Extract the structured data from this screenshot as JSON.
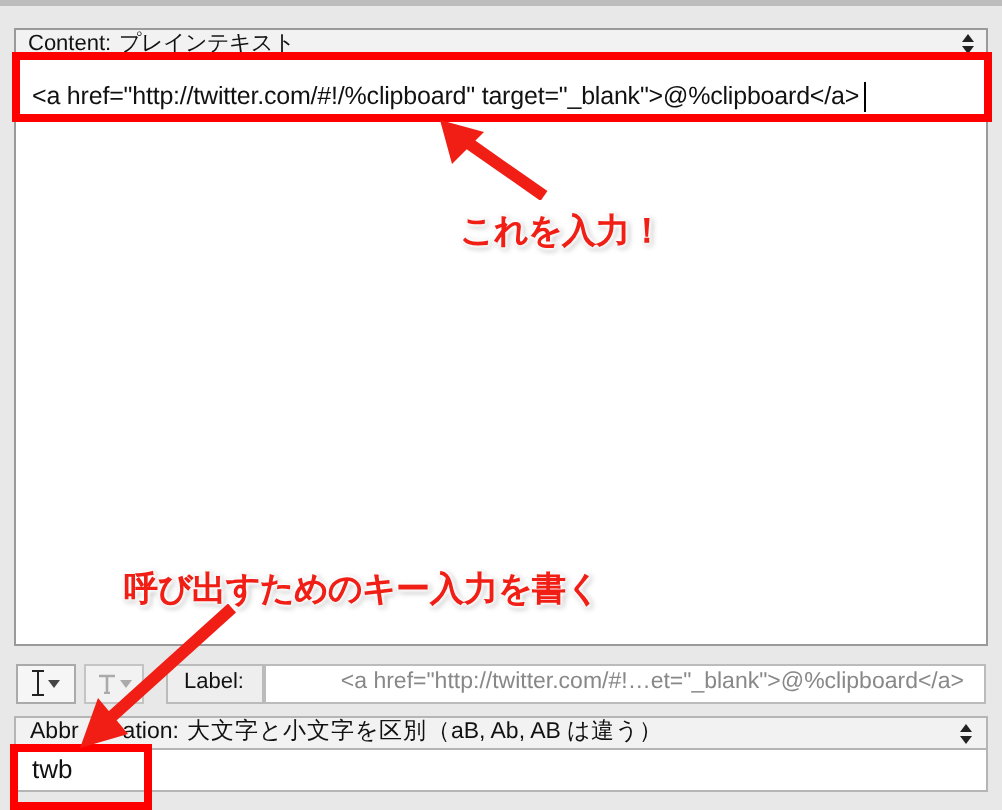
{
  "content_popup": {
    "label": "Content:",
    "value": "プレインテキスト"
  },
  "snippet_text": "<a href=\"http://twitter.com/#!/%clipboard\" target=\"_blank\">@%clipboard</a>",
  "toolbar": {
    "label_button": "Label:",
    "label_value": "<a href=\"http://twitter.com/#!…et=\"_blank\">@%clipboard</a>"
  },
  "abbreviation_popup": {
    "label_fragments": [
      "Abbr",
      "ation:"
    ],
    "value": "大文字と小文字を区別（aB, Ab, AB は違う）"
  },
  "abbreviation_field": {
    "value": "twb"
  },
  "annotations": [
    {
      "text": "これを入力！"
    },
    {
      "text": "呼び出すためのキー入力を書く"
    }
  ]
}
